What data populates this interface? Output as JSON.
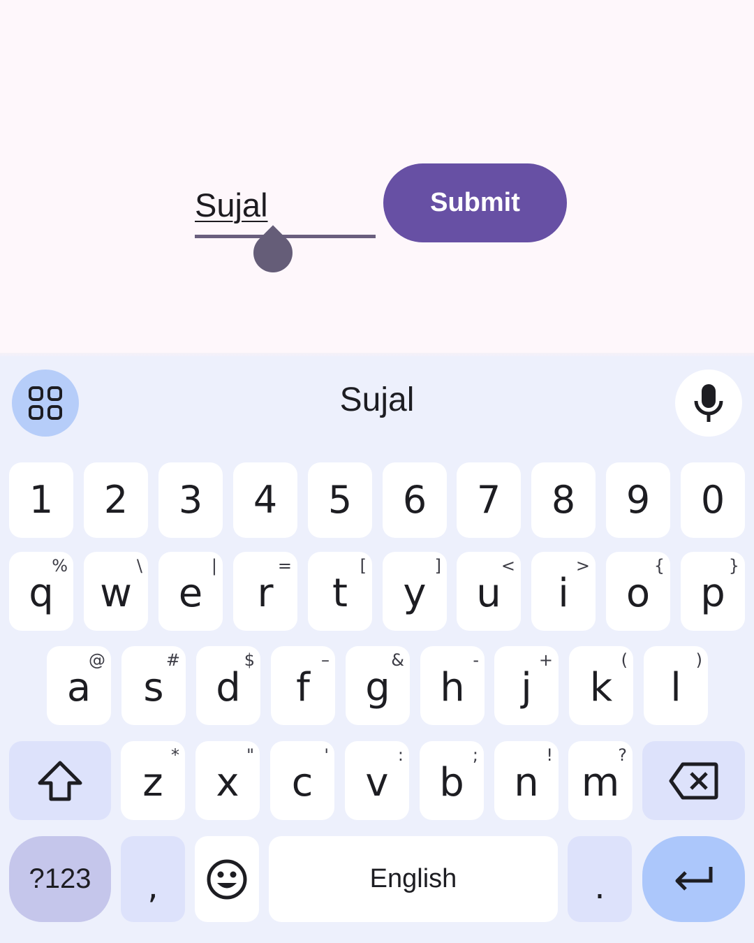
{
  "app": {
    "input_value": "Sujal",
    "submit_label": "Submit"
  },
  "keyboard": {
    "suggestion": "Sujal",
    "number_row": [
      "1",
      "2",
      "3",
      "4",
      "5",
      "6",
      "7",
      "8",
      "9",
      "0"
    ],
    "row1": [
      {
        "key": "q",
        "hint": "%"
      },
      {
        "key": "w",
        "hint": "\\"
      },
      {
        "key": "e",
        "hint": "|"
      },
      {
        "key": "r",
        "hint": "="
      },
      {
        "key": "t",
        "hint": "["
      },
      {
        "key": "y",
        "hint": "]"
      },
      {
        "key": "u",
        "hint": "<"
      },
      {
        "key": "i",
        "hint": ">"
      },
      {
        "key": "o",
        "hint": "{"
      },
      {
        "key": "p",
        "hint": "}"
      }
    ],
    "row2": [
      {
        "key": "a",
        "hint": "@"
      },
      {
        "key": "s",
        "hint": "#"
      },
      {
        "key": "d",
        "hint": "$"
      },
      {
        "key": "f",
        "hint": "–"
      },
      {
        "key": "g",
        "hint": "&"
      },
      {
        "key": "h",
        "hint": "-"
      },
      {
        "key": "j",
        "hint": "+"
      },
      {
        "key": "k",
        "hint": "("
      },
      {
        "key": "l",
        "hint": ")"
      }
    ],
    "row3": [
      {
        "key": "z",
        "hint": "*"
      },
      {
        "key": "x",
        "hint": "\""
      },
      {
        "key": "c",
        "hint": "'"
      },
      {
        "key": "v",
        "hint": ":"
      },
      {
        "key": "b",
        "hint": ";"
      },
      {
        "key": "n",
        "hint": "!"
      },
      {
        "key": "m",
        "hint": "?"
      }
    ],
    "symbols_label": "?123",
    "comma": ",",
    "space_label": "English",
    "period": ".",
    "icons": {
      "apps": "apps-grid-icon",
      "mic": "microphone-icon",
      "shift": "shift-icon",
      "backspace": "backspace-icon",
      "emoji": "emoji-icon",
      "enter": "enter-icon"
    }
  },
  "colors": {
    "accent": "#6750a4",
    "keyboard_bg": "#edf0fc",
    "key_bg": "#ffffff",
    "mod_key_bg": "#dde2fb",
    "symbols_key_bg": "#c5c6eb",
    "enter_key_bg": "#acc7fb"
  }
}
